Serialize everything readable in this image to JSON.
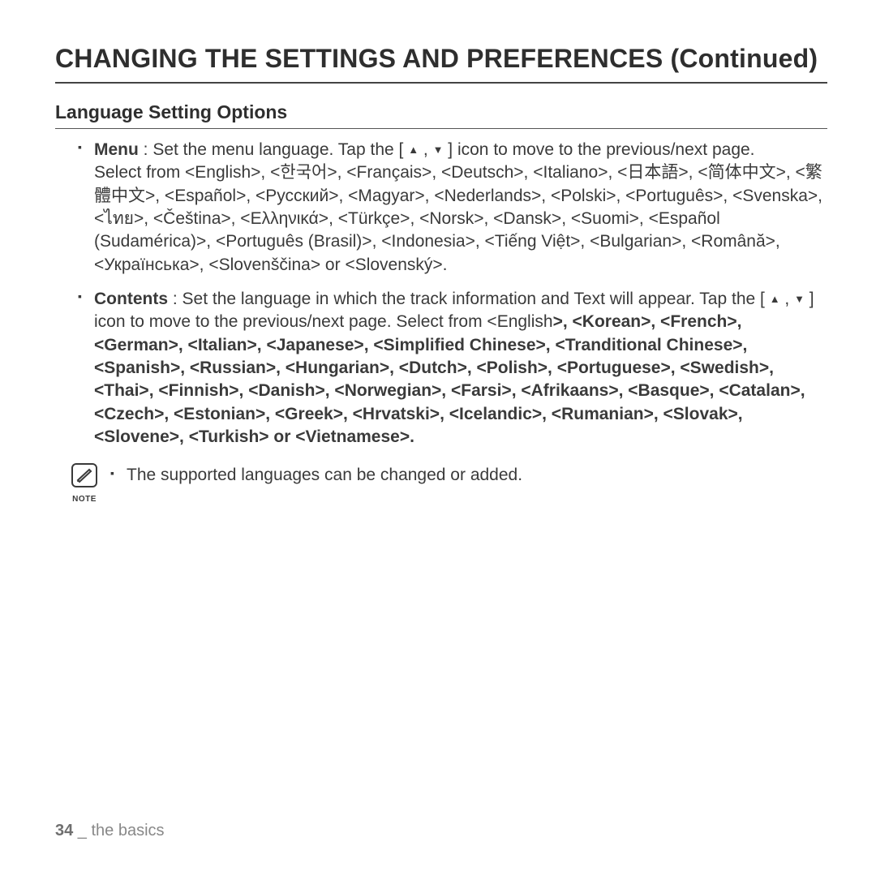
{
  "title": "CHANGING THE SETTINGS AND PREFERENCES (Continued)",
  "section_heading": "Language Setting Options",
  "item1": {
    "label": "Menu",
    "desc_a": " : Set the menu language. Tap the [ ",
    "desc_b": " ] icon to move to the previous/next page.",
    "languages": "Select from <English>, <한국어>, <Français>, <Deutsch>, <Italiano>, <日本語>, <简体中文>, <繁體中文>, <Español>, <Русский>, <Magyar>, <Nederlands>, <Polski>, <Português>, <Svenska>, <ไทย>, <Čeština>, <Ελληνικά>, <Türkçe>, <Norsk>, <Dansk>, <Suomi>, <Español (Sudamérica)>, <Português (Brasil)>, <Indonesia>, <Tiếng Việt>, <Bulgarian>, <Română>, <Українська>, <Slovenščina> or <Slovenský>."
  },
  "item2": {
    "label": "Contents",
    "desc_a": " : Set the language in which the track information and Text will appear. Tap the [ ",
    "desc_b": " ] icon to move to the previous/next page. Select from <English",
    "languages_a": ">, <Korean>, <French>, <German>, <Italian>, <Japanese>, <Simplified Chinese",
    "languages_b": ">, <Tranditional Chinese",
    "languages_c": ">, <Spanish>, <Russian>, <Hungarian>, <Dutch>, <Polish>, <Portuguese>, <Swedish>, <Thai>, <Finnish>, <Danish>, <Norwegian>, <Farsi>, <Afrikaans>, <Basque>, <Catalan>, <Czech>, <Estonian>, <Greek>, <Hrvatski>, <Icelandic>, <Rumanian",
    "languages_d": ">, <Slovak>, <Slovene>, <Turkish> or <Vietnamese>."
  },
  "note": {
    "label": "NOTE",
    "text": "The supported languages can be changed or added."
  },
  "footer": {
    "page_number": "34",
    "separator": " _ ",
    "chapter": "the basics"
  },
  "icons": {
    "up": "▲",
    "comma": " , ",
    "down": "▼"
  }
}
